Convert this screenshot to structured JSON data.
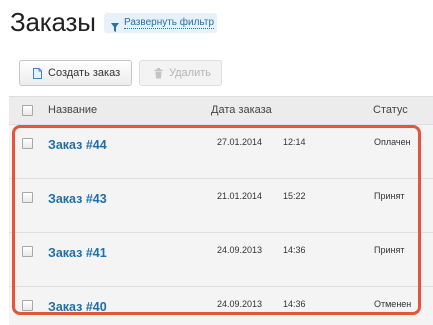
{
  "header": {
    "title": "Заказы",
    "filter_toggle_label": "Развернуть фильтр",
    "filter_icon": "funnel-icon"
  },
  "toolbar": {
    "create_label": "Создать заказ",
    "create_icon": "document-icon",
    "delete_label": "Удалить",
    "delete_icon": "trash-icon",
    "delete_disabled": true
  },
  "table": {
    "columns": {
      "name": "Название",
      "date": "Дата заказа",
      "status": "Статус"
    },
    "rows": [
      {
        "name": "Заказ #44",
        "date": "27.01.2014",
        "time": "12:14",
        "status": "Оплачен"
      },
      {
        "name": "Заказ #43",
        "date": "21.01.2014",
        "time": "15:22",
        "status": "Принят"
      },
      {
        "name": "Заказ #41",
        "date": "24.09.2013",
        "time": "14:36",
        "status": "Принят"
      },
      {
        "name": "Заказ #40",
        "date": "24.09.2013",
        "time": "14:36",
        "status": "Отменен"
      }
    ]
  },
  "colors": {
    "link": "#1e6fae",
    "highlight": "#e4563b",
    "filter_bg": "#e6f1f9"
  }
}
